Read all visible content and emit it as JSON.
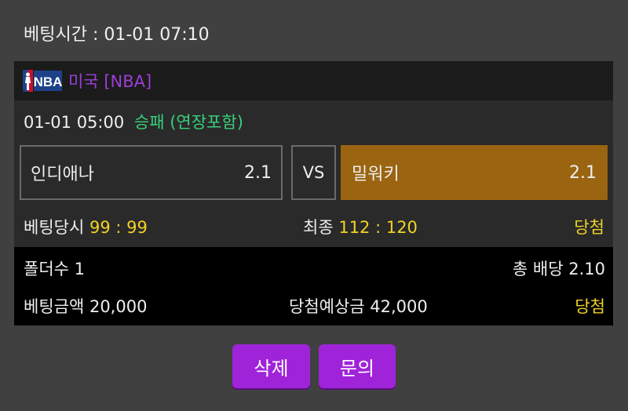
{
  "header": {
    "bet_time": "베팅시간 : 01-01 07:10"
  },
  "league": {
    "icon": "nba-logo-icon",
    "name": "미국 [NBA]",
    "color": "#9b3fd6"
  },
  "game": {
    "time": "01-01 05:00",
    "market": "승패 (연장포함)",
    "home": {
      "name": "인디애나",
      "odds": "2.1"
    },
    "vs_label": "VS",
    "away": {
      "name": "밀워키",
      "odds": "2.1",
      "selected": true
    }
  },
  "scores": {
    "at_bet_label": "베팅당시",
    "at_bet_value": "99 : 99",
    "final_label": "최종",
    "final_value": "112 : 120",
    "result": "당첨"
  },
  "summary": {
    "folder_count": "폴더수 1",
    "total_odds": "총 배당 2.10",
    "bet_amount": "베팅금액 20,000",
    "expected_win": "당첨예상금 42,000",
    "result": "당첨"
  },
  "buttons": {
    "delete": "삭제",
    "inquiry": "문의"
  },
  "colors": {
    "selected_team": "#9b6411",
    "result_yellow": "#f1d226",
    "market_green": "#38d07a",
    "button_purple": "#9f23d9"
  }
}
